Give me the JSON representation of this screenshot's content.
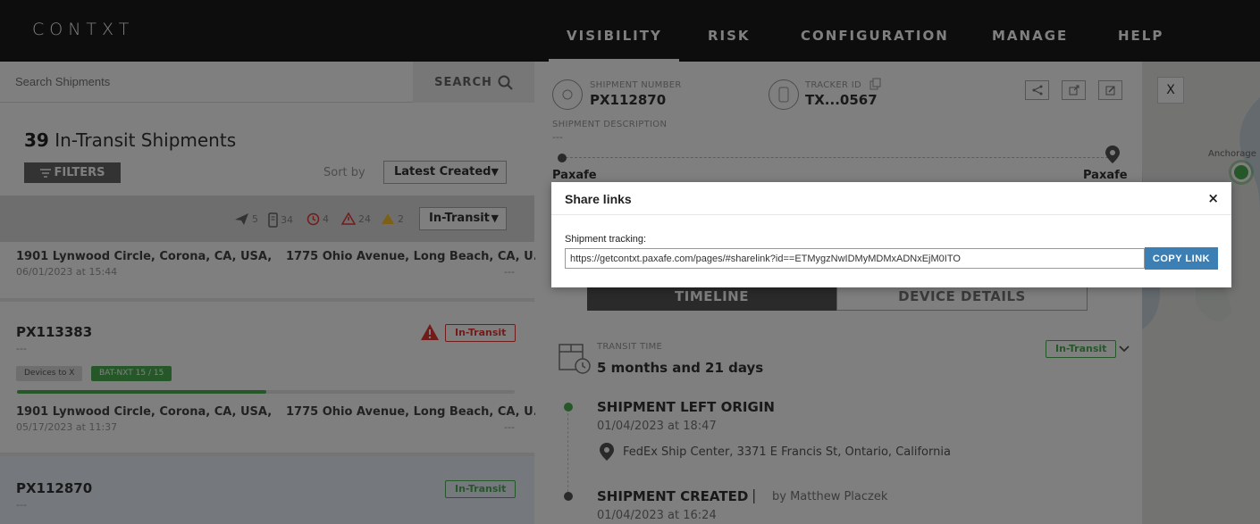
{
  "app": {
    "logo": "CONTXT"
  },
  "nav": {
    "items": [
      {
        "label": "VISIBILITY"
      },
      {
        "label": "RISK"
      },
      {
        "label": "CONFIGURATION"
      },
      {
        "label": "MANAGE"
      },
      {
        "label": "HELP"
      }
    ],
    "active": "VISIBILITY"
  },
  "search": {
    "placeholder": "Search Shipments",
    "button_label": "SEARCH"
  },
  "list": {
    "count": "39",
    "title_suffix": "In-Transit Shipments",
    "filters_label": "FILTERS",
    "sort_label": "Sort by",
    "sort_value": "Latest Created",
    "stats": {
      "airplane": "5",
      "tracker": "34",
      "clock": "4",
      "alert_red": "24",
      "alert_yellow": "2"
    },
    "status_value": "In-Transit",
    "cards": [
      {
        "origin": "1901 Lynwood Circle, Corona, CA, USA,",
        "destination": "1775 Ohio Avenue, Long Beach, CA, U...",
        "date": "06/01/2023 at 15:44",
        "dest_sub": "---"
      },
      {
        "id": "PX113383",
        "desc": "---",
        "status": "In-Transit",
        "tags": [
          "Devices to X",
          "BAT-NXT 15 / 15"
        ],
        "progress": 0.5,
        "origin": "1901 Lynwood Circle, Corona, CA, USA,",
        "destination": "1775 Ohio Avenue, Long Beach, CA, U...",
        "date": "05/17/2023 at 11:37",
        "dest_sub": "---"
      },
      {
        "id": "PX112870",
        "desc": "---",
        "status": "In-Transit"
      }
    ]
  },
  "detail": {
    "shipment_number_label": "SHIPMENT NUMBER",
    "shipment_number": "PX112870",
    "tracker_id_label": "TRACKER ID",
    "tracker_id": "TX...0567",
    "description_label": "SHIPMENT DESCRIPTION",
    "description": "---",
    "origin_name": "Paxafe",
    "destination_name": "Paxafe",
    "tabs": [
      "TIMELINE",
      "DEVICE DETAILS"
    ],
    "transit_time_label": "TRANSIT TIME",
    "transit_time": "5 months and 21 days",
    "status_badge": "In-Transit",
    "timeline": [
      {
        "title": "SHIPMENT LEFT ORIGIN",
        "date": "01/04/2023 at 18:47",
        "location": "FedEx Ship Center, 3371 E Francis St, Ontario, California"
      },
      {
        "title": "SHIPMENT CREATED",
        "by": "by Matthew Placzek",
        "date": "01/04/2023 at 16:24"
      }
    ]
  },
  "map": {
    "close_label": "X",
    "labels": [
      "Anchorage"
    ]
  },
  "modal": {
    "title": "Share links",
    "close": "×",
    "field_label": "Shipment tracking:",
    "link_value": "https://getcontxt.paxafe.com/pages/#sharelink?id==ETMygzNwIDMyMDMxADNxEjM0ITO",
    "copy_label": "COPY LINK"
  },
  "colors": {
    "green": "#4caf50",
    "red": "#e53935",
    "yellow": "#fbc02d",
    "blue": "#3b7fb4"
  }
}
